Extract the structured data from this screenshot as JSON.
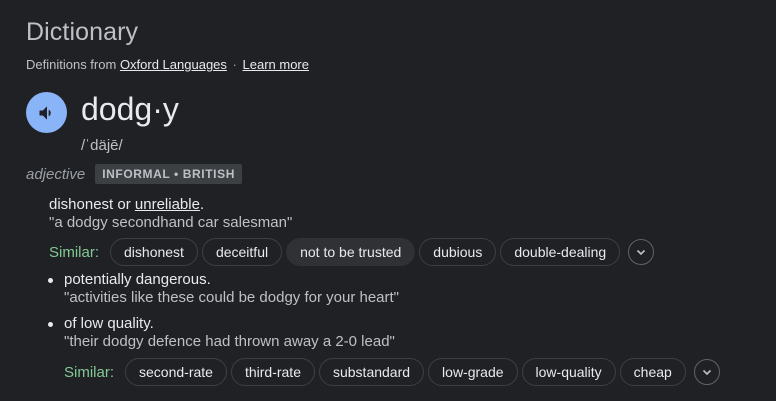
{
  "header": {
    "title": "Dictionary",
    "source_prefix": "Definitions from",
    "source_link": "Oxford Languages",
    "separator": "·",
    "learn_more": "Learn more"
  },
  "entry": {
    "word": "dodg·y",
    "phonetic": "/ˈdäjē/",
    "part_of_speech": "adjective",
    "label": "INFORMAL • BRITISH",
    "speaker_icon": "speaker-icon"
  },
  "senses": [
    {
      "definition_before": "dishonest or ",
      "definition_link": "unreliable",
      "definition_after": ".",
      "example": "\"a dodgy secondhand car salesman\"",
      "similar_label": "Similar:",
      "similar": [
        "dishonest",
        "deceitful",
        "not to be trusted",
        "dubious",
        "double-dealing"
      ]
    },
    {
      "definition": "potentially dangerous.",
      "example": "\"activities like these could be dodgy for your heart\""
    },
    {
      "definition": "of low quality.",
      "example": "\"their dodgy defence had thrown away a 2-0 lead\"",
      "similar_label": "Similar:",
      "similar": [
        "second-rate",
        "third-rate",
        "substandard",
        "low-grade",
        "low-quality",
        "cheap"
      ]
    }
  ],
  "colors": {
    "background": "#202124",
    "speaker": "#8ab4f8",
    "similar_label": "#81c995"
  }
}
